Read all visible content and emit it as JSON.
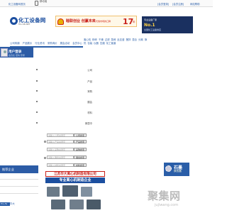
{
  "topbar": {
    "home_link": "化工设备网首页",
    "mobile_label": "移动端",
    "login": "[会员登录]",
    "register": "[会员注册]",
    "help": "网站帮助"
  },
  "logo": {
    "name": "化工设备网",
    "domain": "HG-SB.NET"
  },
  "banner": {
    "slogan": "睦联创业 创赢未来",
    "sub": "凭借市场的口碑",
    "num": "17",
    "unit": "年"
  },
  "adbox": {
    "line1": "专业设备厂家",
    "line2": "No.1",
    "line3": "全国化工设备供应"
  },
  "nav": {
    "items": [
      "公司商铺",
      "产品展示",
      "行业资讯",
      "采购询价",
      "展会活动",
      "会员中心"
    ]
  },
  "category_links": [
    "离心机",
    "粉碎",
    "干燥",
    "过滤",
    "泵阀",
    "反应釜",
    "搅拌",
    "混合",
    "分离",
    "换热",
    "包装",
    "仪器",
    "压缩",
    "化工管道"
  ],
  "user": {
    "title": "用户登录",
    "sub": "会员名 密码 登录"
  },
  "main_list": [
    "公司",
    "产品",
    "采购",
    "展会",
    "材料",
    "家居中"
  ],
  "form": {
    "fields": [
      {
        "placeholder": "请输入公司关键字",
        "button": "公司搜索"
      },
      {
        "placeholder": "请输入产品关键字",
        "button": "产品搜索"
      },
      {
        "placeholder": "请输入采购关键字",
        "button": "采购搜索"
      },
      {
        "placeholder": "请输入展会关键字",
        "button": "展会搜索"
      },
      {
        "placeholder": "请输入材料关键字",
        "button": "材料搜索"
      },
      {
        "placeholder": "请输入家居关键字",
        "button": "家居搜索"
      }
    ]
  },
  "side_ad": {
    "title": "石墨",
    "sub": "换热器"
  },
  "left_box": {
    "title": "推荐企业"
  },
  "company_ad": {
    "line1": "江苏华大离心机制造有限公司",
    "line2": "专业离心机制造企业"
  },
  "mini": {
    "tag": "Pro-Fa",
    "text": "华大"
  },
  "watermark": {
    "main": "聚集网",
    "sub": "jujiwang.com"
  }
}
